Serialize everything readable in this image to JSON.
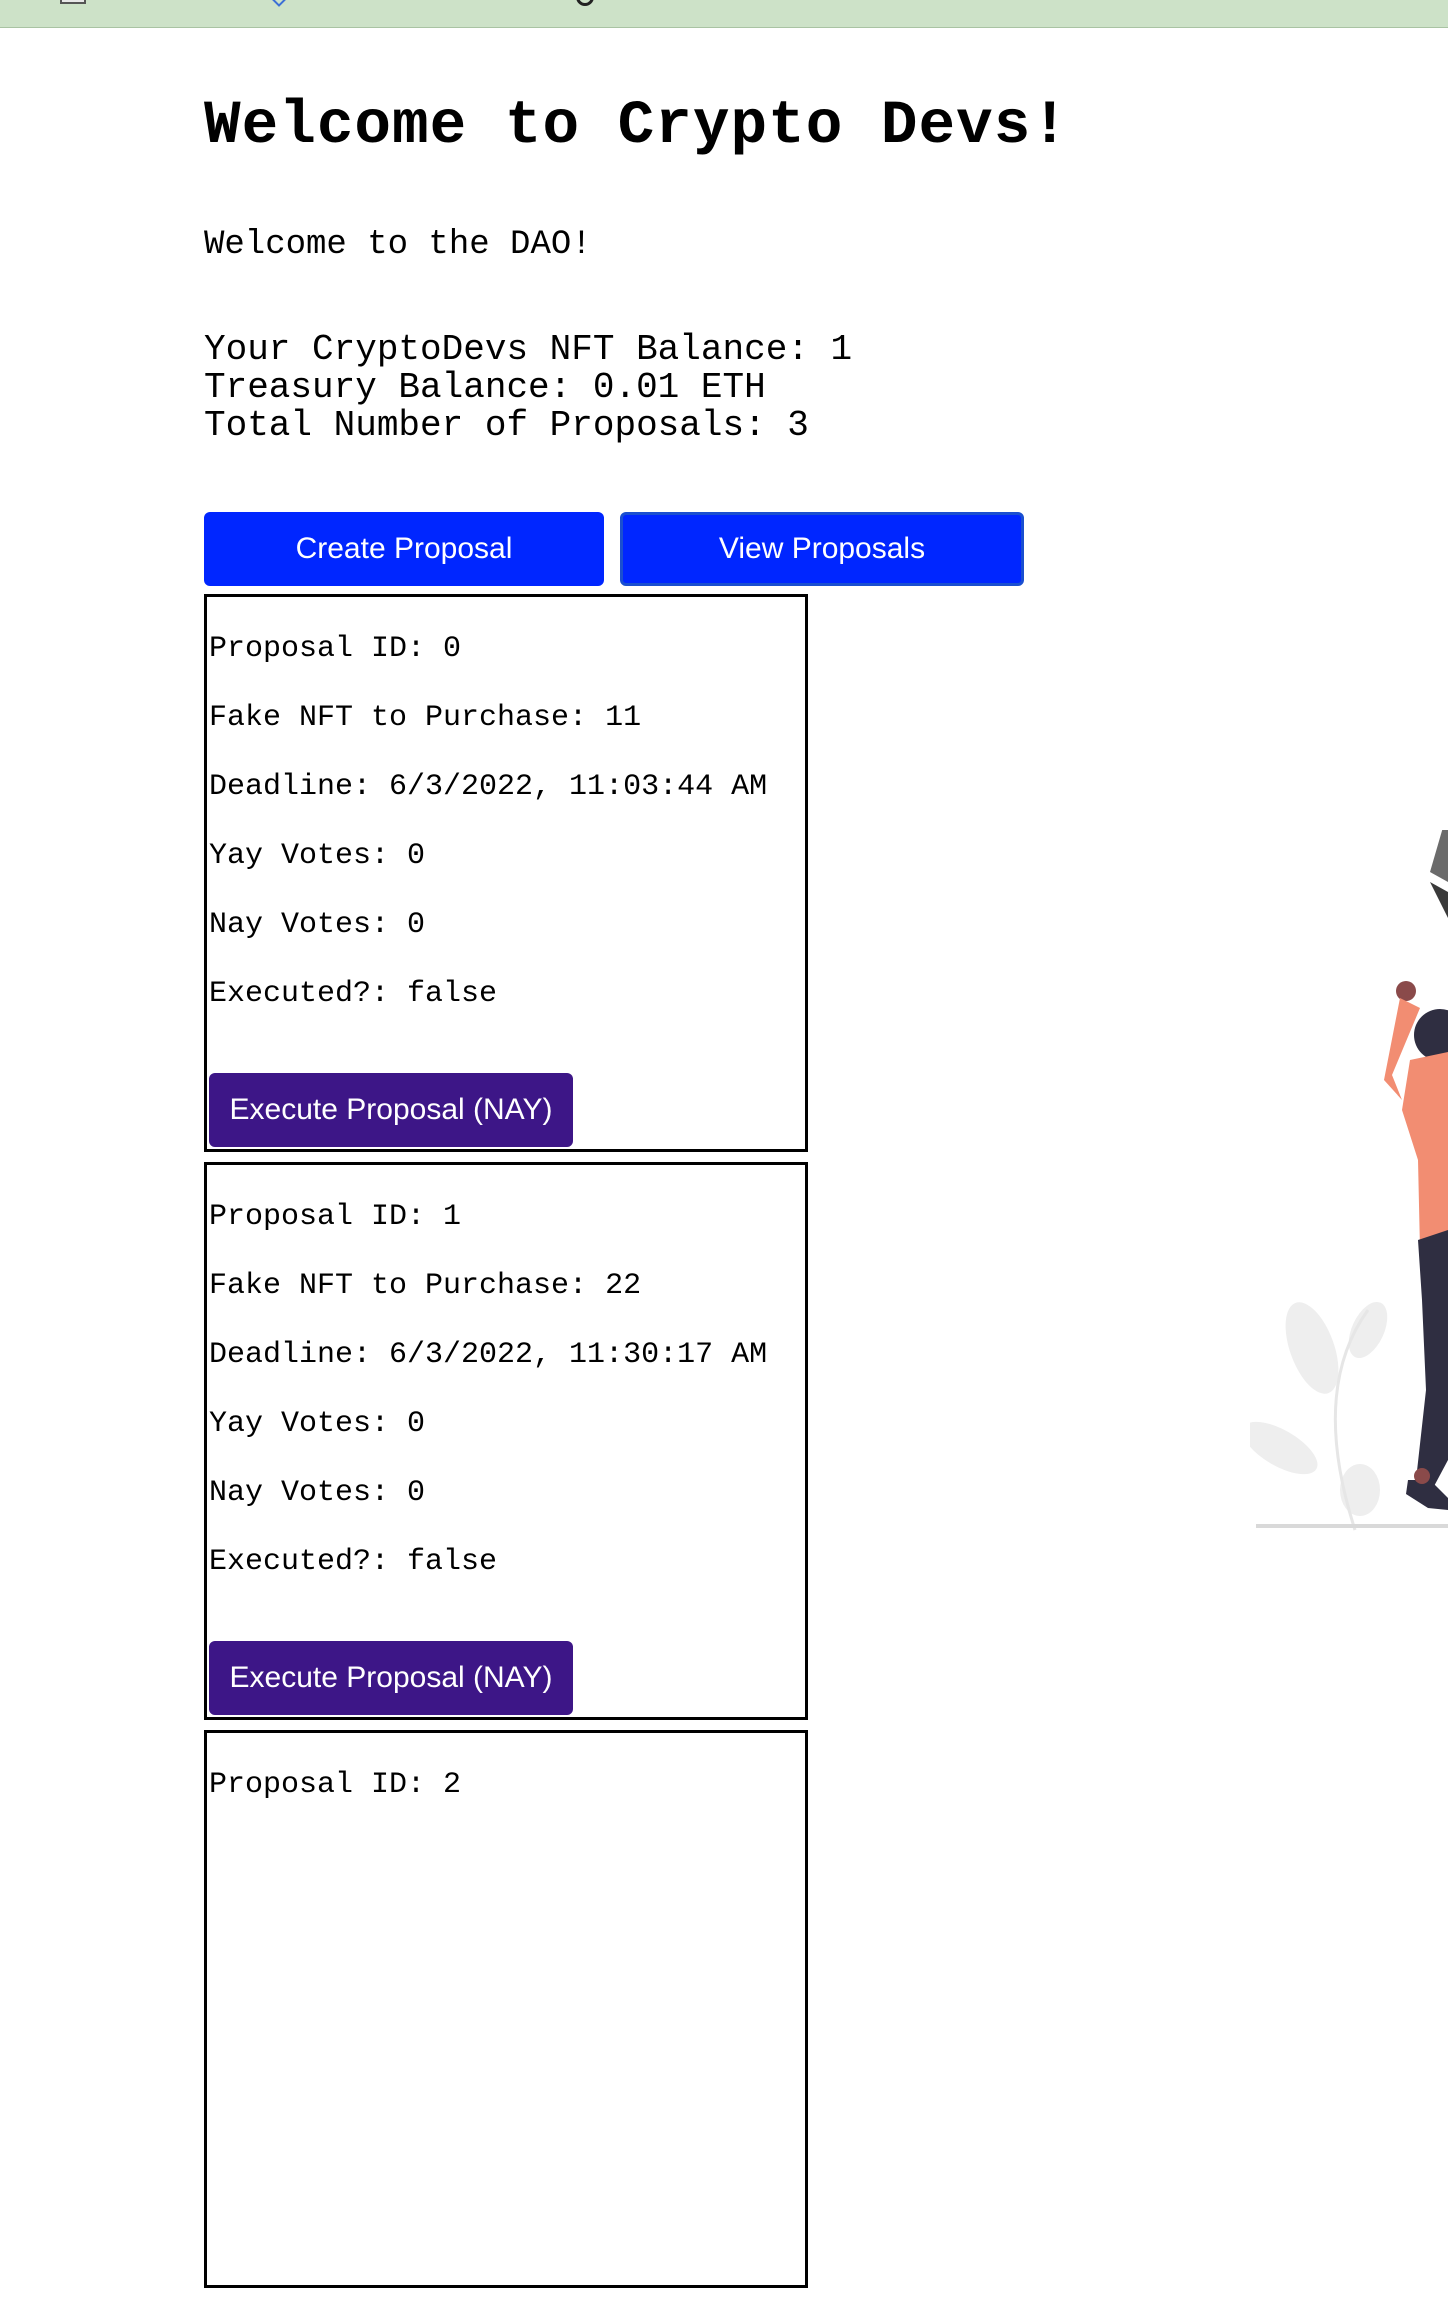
{
  "page": {
    "title": "Welcome to Crypto Devs!",
    "subtitle": "Welcome to the DAO!",
    "stats": {
      "nft_balance": "Your CryptoDevs NFT Balance: 1",
      "treasury_balance": "Treasury Balance: 0.01 ETH",
      "total_proposals": "Total Number of Proposals: 3"
    }
  },
  "actions": {
    "create_label": "Create Proposal",
    "view_label": "View Proposals"
  },
  "proposals": [
    {
      "id": "Proposal ID: 0",
      "nft": "Fake NFT to Purchase: 11",
      "deadline": "Deadline: 6/3/2022, 11:03:44 AM",
      "yay": "Yay Votes: 0",
      "nay": "Nay Votes: 0",
      "executed": "Executed?: false",
      "execute_label": "Execute Proposal (NAY)"
    },
    {
      "id": "Proposal ID: 1",
      "nft": "Fake NFT to Purchase: 22",
      "deadline": "Deadline: 6/3/2022, 11:30:17 AM",
      "yay": "Yay Votes: 0",
      "nay": "Nay Votes: 0",
      "executed": "Executed?: false",
      "execute_label": "Execute Proposal (NAY)"
    },
    {
      "id": "Proposal ID: 2"
    }
  ],
  "colors": {
    "primary_button": "#0026ff",
    "execute_button": "#3d1687",
    "browser_strip": "#cde2c8"
  }
}
